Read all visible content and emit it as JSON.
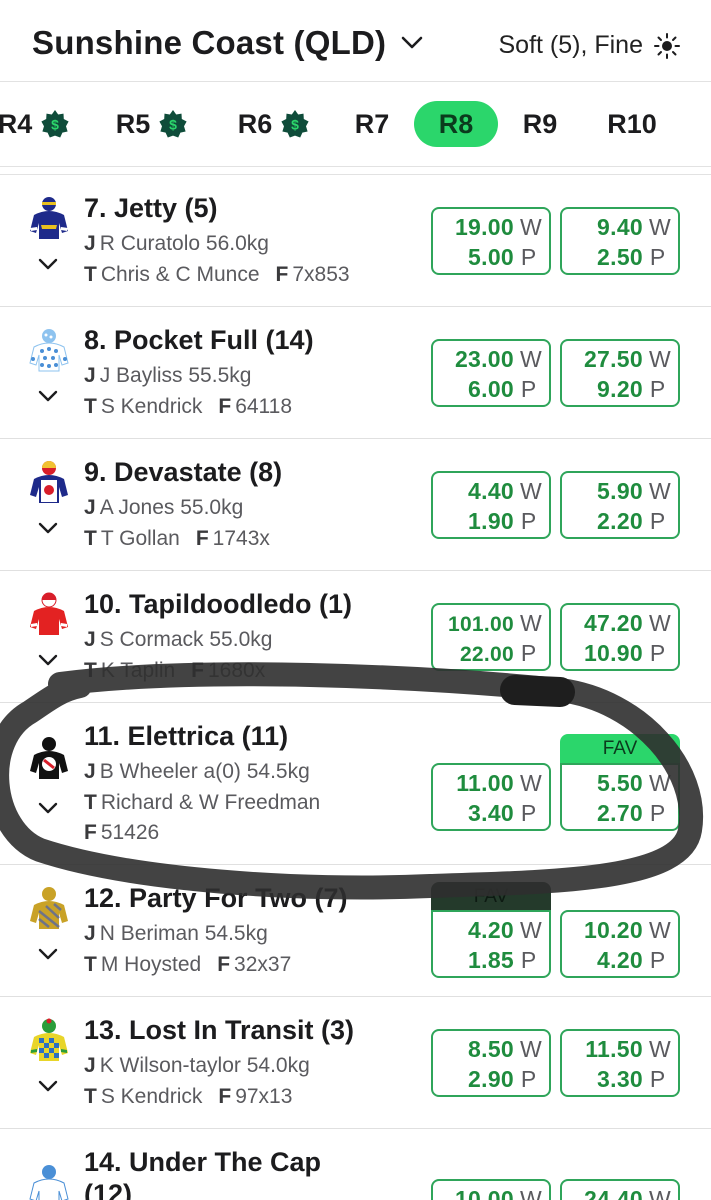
{
  "header": {
    "venue": "Sunshine Coast (QLD)",
    "conditions": "Soft (5), Fine"
  },
  "tabs": [
    {
      "label": "R4",
      "money": true
    },
    {
      "label": "R5",
      "money": true
    },
    {
      "label": "R6",
      "money": true
    },
    {
      "label": "R7",
      "money": false
    },
    {
      "label": "R8",
      "money": false,
      "active": true
    },
    {
      "label": "R9",
      "money": false
    },
    {
      "label": "R10",
      "money": false
    }
  ],
  "labels": {
    "jockey": "J",
    "trainer": "T",
    "form": "F",
    "win": "W",
    "place": "P",
    "fav": "FAV"
  },
  "runners": [
    {
      "name": "7. Jetty (5)",
      "jockey": "R Curatolo 56.0kg",
      "trainer": "Chris & C Munce",
      "form": "7x853",
      "odds1": {
        "win": "19.00",
        "place": "5.00"
      },
      "odds2": {
        "win": "9.40",
        "place": "2.50"
      }
    },
    {
      "name": "8. Pocket Full (14)",
      "jockey": "J Bayliss 55.5kg",
      "trainer": "S Kendrick",
      "form": "64118",
      "odds1": {
        "win": "23.00",
        "place": "6.00"
      },
      "odds2": {
        "win": "27.50",
        "place": "9.20"
      }
    },
    {
      "name": "9. Devastate (8)",
      "jockey": "A Jones 55.0kg",
      "trainer": "T Gollan",
      "form": "1743x",
      "odds1": {
        "win": "4.40",
        "place": "1.90"
      },
      "odds2": {
        "win": "5.90",
        "place": "2.20"
      }
    },
    {
      "name": "10. Tapildoodledo (1)",
      "jockey": "S Cormack 55.0kg",
      "trainer": "K Taplin",
      "form": "1680x",
      "odds1": {
        "win": "101.00",
        "place": "22.00"
      },
      "odds2": {
        "win": "47.20",
        "place": "10.90"
      }
    },
    {
      "name": "11. Elettrica (11)",
      "jockey": "B Wheeler a(0) 54.5kg",
      "trainer": "Richard & W Freedman",
      "form": "51426",
      "odds1": {
        "win": "11.00",
        "place": "3.40"
      },
      "odds2": {
        "win": "5.50",
        "place": "2.70"
      }
    },
    {
      "name": "12. Party For Two (7)",
      "jockey": "N Beriman 54.5kg",
      "trainer": "M Hoysted",
      "form": "32x37",
      "odds1": {
        "win": "4.20",
        "place": "1.85"
      },
      "odds2": {
        "win": "10.20",
        "place": "4.20"
      }
    },
    {
      "name": "13. Lost In Transit (3)",
      "jockey": "K Wilson-taylor 54.0kg",
      "trainer": "S Kendrick",
      "form": "97x13",
      "odds1": {
        "win": "8.50",
        "place": "2.90"
      },
      "odds2": {
        "win": "11.50",
        "place": "3.30"
      }
    },
    {
      "name": "14. Under The Cap",
      "line2": "(12)",
      "odds1": {
        "win": "10.00",
        "place": ""
      },
      "odds2": {
        "win": "24.40",
        "place": ""
      }
    }
  ]
}
